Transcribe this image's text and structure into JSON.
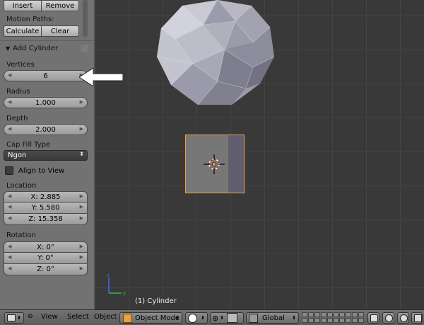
{
  "toolshelf": {
    "insert_label": "Insert",
    "remove_label": "Remove",
    "motion_paths_label": "Motion Paths:",
    "calculate_label": "Calculate",
    "clear_label": "Clear",
    "operator_title": "Add Cylinder",
    "vertices_label": "Vertices",
    "vertices_value": "6",
    "radius_label": "Radius",
    "radius_value": "1.000",
    "depth_label": "Depth",
    "depth_value": "2.000",
    "cap_fill_label": "Cap Fill Type",
    "cap_fill_value": "Ngon",
    "align_to_view_label": "Align to View",
    "location_label": "Location",
    "location_x": "X: 2.885",
    "location_y": "Y: 5.580",
    "location_z": "Z: 15.358",
    "rotation_label": "Rotation",
    "rotation_x": "X: 0°",
    "rotation_y": "Y: 0°",
    "rotation_z": "Z: 0°"
  },
  "viewport": {
    "object_label": "(1) Cylinder",
    "selection_color": "#f5a040",
    "arrow_color": "#ffffff"
  },
  "header": {
    "view_label": "View",
    "select_label": "Select",
    "object_label": "Object",
    "mode_label": "Object Mode",
    "orientation_label": "Global"
  }
}
